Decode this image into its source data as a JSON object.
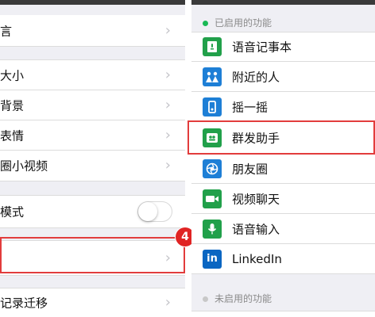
{
  "left_panel": {
    "items": [
      {
        "label": "言"
      },
      {
        "label": "大小"
      },
      {
        "label": "背景"
      },
      {
        "label": "表情"
      },
      {
        "label": "圈小视频"
      },
      {
        "label": "模式"
      },
      {
        "label": ""
      },
      {
        "label": "记录迁移"
      }
    ],
    "toggle_state": "off",
    "step_badge": "4"
  },
  "right_panel": {
    "enabled_header": "已启用的功能",
    "disabled_header": "未启用的功能",
    "features": [
      {
        "label": "语音记事本",
        "icon": "voice-notebook-icon"
      },
      {
        "label": "附近的人",
        "icon": "nearby-people-icon"
      },
      {
        "label": "摇一摇",
        "icon": "shake-icon"
      },
      {
        "label": "群发助手",
        "icon": "broadcast-assistant-icon"
      },
      {
        "label": "朋友圈",
        "icon": "moments-icon"
      },
      {
        "label": "视频聊天",
        "icon": "video-chat-icon"
      },
      {
        "label": "语音输入",
        "icon": "voice-input-icon"
      },
      {
        "label": "LinkedIn",
        "icon": "linkedin-icon"
      }
    ]
  },
  "colors": {
    "enabled_dot": "#19b955",
    "disabled_dot": "#c8c8c8",
    "highlight": "#e23c3c",
    "badge": "#e02424",
    "green_icon": "#21a04a",
    "blue_icon": "#1e7fd6",
    "linkedin": "#0a66c2"
  }
}
